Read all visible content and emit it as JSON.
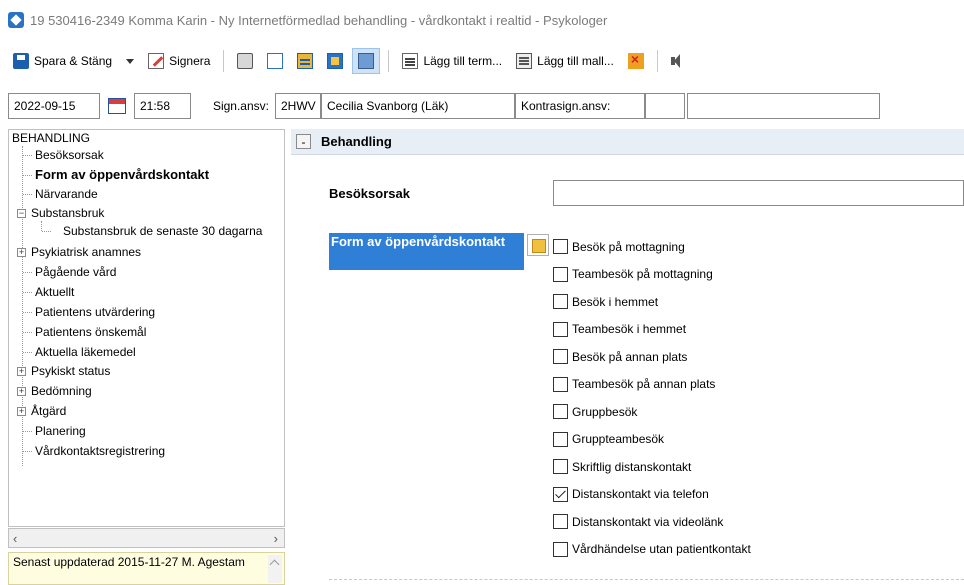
{
  "window": {
    "title": "19 530416-2349 Komma Karin - Ny Internetförmedlad behandling - vårdkontakt i realtid - Psykologer"
  },
  "toolbar": {
    "save_close": "Spara & Stäng",
    "sign": "Signera",
    "add_term": "Lägg till term...",
    "add_template": "Lägg till mall..."
  },
  "signrow": {
    "date": "2022-09-15",
    "time": "21:58",
    "sign_label": "Sign.ansv:",
    "sign_code": "2HWV",
    "sign_name": "Cecilia Svanborg (Läk)",
    "countersign_label": "Kontrasign.ansv:",
    "countersign_code": "",
    "countersign_name": ""
  },
  "tree": {
    "root": "BEHANDLING",
    "items": [
      {
        "label": "Besöksorsak"
      },
      {
        "label": "Form av öppenvårdskontakt",
        "selected": true
      },
      {
        "label": "Närvarande"
      },
      {
        "label": "Substansbruk",
        "expanded": true
      },
      {
        "label": "Substansbruk de senaste 30 dagarna"
      },
      {
        "label": "Psykiatrisk anamnes",
        "collapsed": true
      },
      {
        "label": "Pågående vård"
      },
      {
        "label": "Aktuellt"
      },
      {
        "label": "Patientens utvärdering"
      },
      {
        "label": "Patientens önskemål"
      },
      {
        "label": "Aktuella läkemedel"
      },
      {
        "label": "Psykiskt status",
        "collapsed": true
      },
      {
        "label": "Bedömning",
        "collapsed": true
      },
      {
        "label": "Åtgärd",
        "collapsed": true
      },
      {
        "label": "Planering"
      },
      {
        "label": "Vårdkontaktsregistrering"
      }
    ]
  },
  "footer": {
    "updated": "Senast uppdaterad 2015-11-27 M. Agestam"
  },
  "section": {
    "title": "Behandling",
    "collapse_symbol": "-"
  },
  "fields": {
    "visit_reason_label": "Besöksorsak",
    "visit_reason_value": "",
    "contact_form_label": "Form av öppenvårdskontakt",
    "options": [
      {
        "label": "Besök på mottagning",
        "checked": false
      },
      {
        "label": "Teambesök på mottagning",
        "checked": false
      },
      {
        "label": "Besök i hemmet",
        "checked": false
      },
      {
        "label": "Teambesök i hemmet",
        "checked": false
      },
      {
        "label": "Besök på annan plats",
        "checked": false
      },
      {
        "label": "Teambesök på annan plats",
        "checked": false
      },
      {
        "label": "Gruppbesök",
        "checked": false
      },
      {
        "label": "Gruppteambesök",
        "checked": false
      },
      {
        "label": "Skriftlig distanskontakt",
        "checked": false
      },
      {
        "label": "Distanskontakt via telefon",
        "checked": true
      },
      {
        "label": "Distanskontakt via videolänk",
        "checked": false
      },
      {
        "label": "Vårdhändelse utan patientkontakt",
        "checked": false
      }
    ]
  },
  "colors": {
    "selection": "#2f7fd6",
    "section_header_bg": "#e8eef5",
    "note_bg": "#fffde0"
  },
  "icons": [
    "app-icon",
    "save-icon",
    "chevron-down-icon",
    "pencil-icon",
    "printer-icon",
    "document-icon",
    "list-icon",
    "panel-icon",
    "grid-icon",
    "term-icon",
    "template-icon",
    "delete-icon",
    "speaker-icon",
    "calendar-icon",
    "note-icon"
  ]
}
